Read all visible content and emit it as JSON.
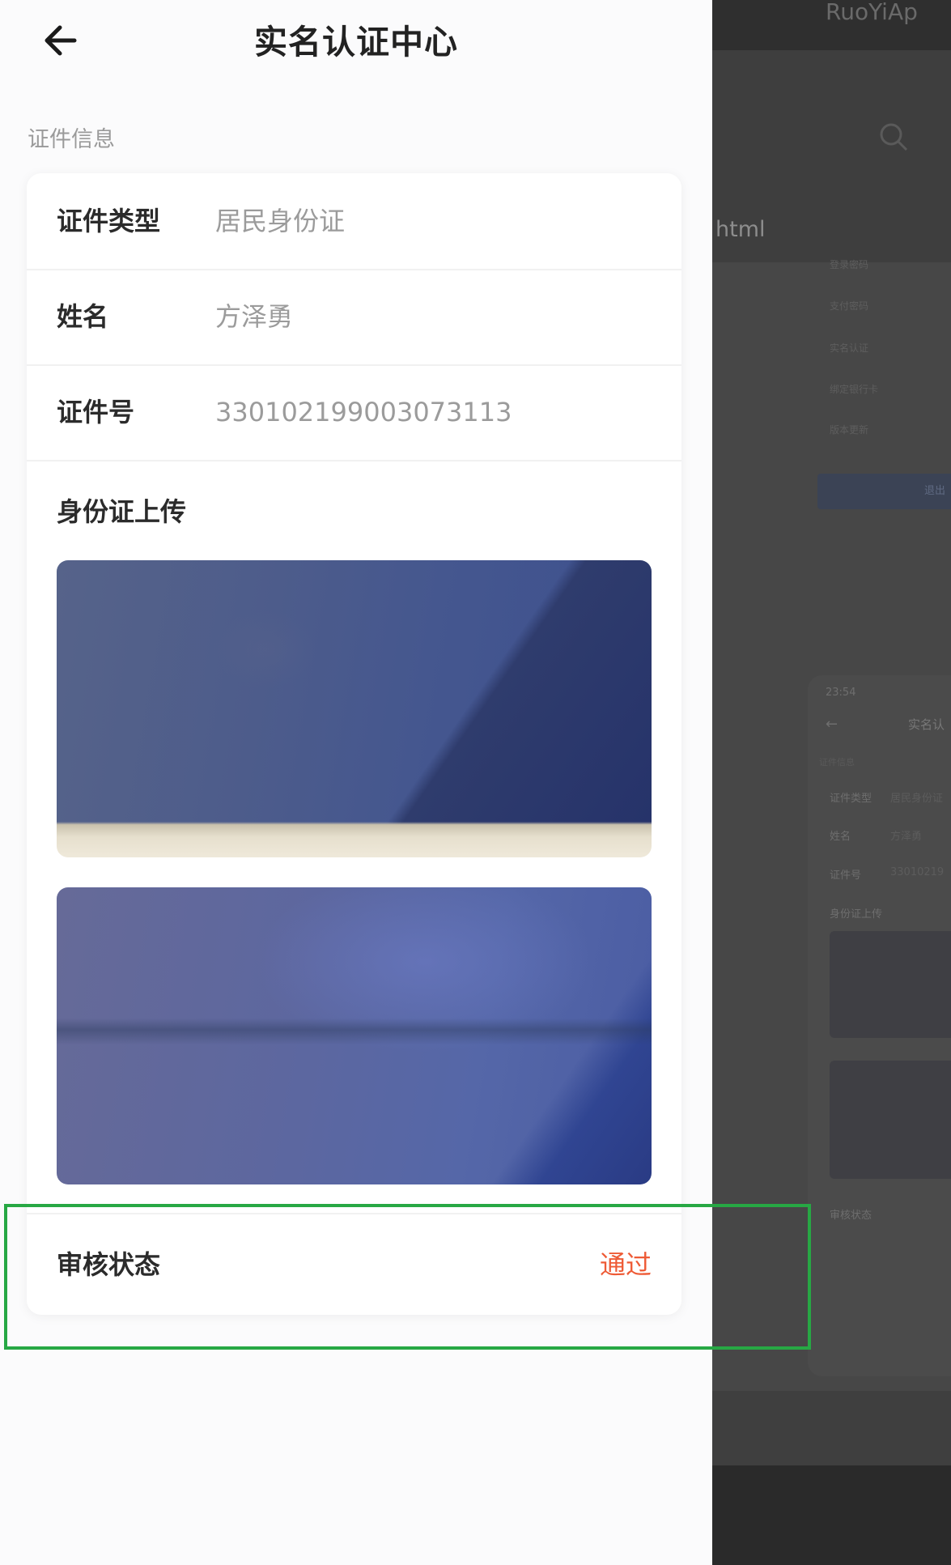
{
  "header": {
    "title": "实名认证中心",
    "back_icon": "arrow-left-icon"
  },
  "section": {
    "label": "证件信息"
  },
  "fields": [
    {
      "label": "证件类型",
      "value": "居民身份证"
    },
    {
      "label": "姓名",
      "value": "方泽勇"
    },
    {
      "label": "证件号",
      "value": "330102199003073113"
    }
  ],
  "upload": {
    "label": "身份证上传"
  },
  "review": {
    "label": "审核状态",
    "status": "通过",
    "status_color": "#ee5b36"
  },
  "background": {
    "app_name": "RuoYiAp",
    "url_fragment": "html",
    "mini_menu": [
      "登录密码",
      "支付密码",
      "实名认证",
      "绑定银行卡",
      "版本更新"
    ],
    "mini_button": "退出",
    "mini_time": "23:54",
    "mini_title": "实名认",
    "mini_section": "证件信息",
    "mini_fields": [
      "证件类型",
      "姓名",
      "证件号"
    ],
    "mini_values": [
      "居民身份证",
      "方泽勇",
      "33010219"
    ],
    "mini_upload": "身份证上传",
    "mini_review": "审核状态"
  },
  "annotation": {
    "highlight_color": "#27a844"
  }
}
